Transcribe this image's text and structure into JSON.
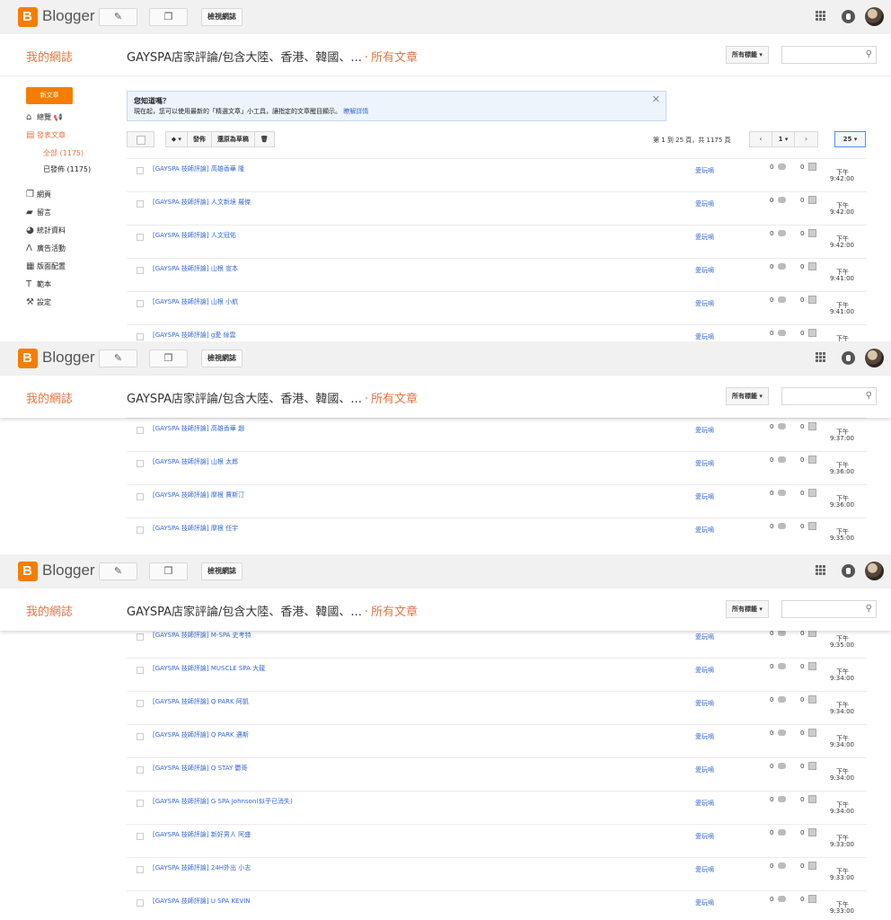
{
  "topbar": {
    "logo_letter": "B",
    "brand": "Blogger",
    "view_blog": "檢視網誌",
    "pencil_icon": "pencil-icon",
    "pages_icon": "pages-icon"
  },
  "header": {
    "blog_name": "我的網誌",
    "blog_title": "GAYSPA店家評論/包含大陸、香港、韓國、...",
    "separator": "·",
    "section": "所有文章",
    "labels_dropdown": "所有標籤 ▾"
  },
  "sidebar": {
    "new_post": "新文章",
    "items": [
      {
        "label": "總覽",
        "icon": "home-icon"
      },
      {
        "label": "發表文章",
        "icon": "posts-icon"
      },
      {
        "label": "全部 (1175)"
      },
      {
        "label": "已發佈 (1175)"
      },
      {
        "label": "網頁",
        "icon": "pages-icon"
      },
      {
        "label": "留言",
        "icon": "comments-icon"
      },
      {
        "label": "統計資料",
        "icon": "stats-icon"
      },
      {
        "label": "廣告活動",
        "icon": "earnings-icon"
      },
      {
        "label": "版面配置",
        "icon": "layout-icon"
      },
      {
        "label": "範本",
        "icon": "theme-icon"
      },
      {
        "label": "設定",
        "icon": "settings-icon"
      }
    ]
  },
  "notice": {
    "title": "您知道嗎？",
    "body": "現在起，您可以使用最新的「精選文章」小工具，讓指定的文章醒目顯示。",
    "link": "瞭解詳情"
  },
  "toolbar": {
    "label_btn": "▾",
    "publish": "發佈",
    "revert": "還原為草稿",
    "delete_icon": "trash-icon",
    "page_info": "第 1 到 25 頁，共 1175 頁",
    "page_prev": "‹",
    "page_num": "1 ▾",
    "page_next": "›",
    "per_page": "25 ▾"
  },
  "posts": [
    {
      "title": "[GAYSPA 技師評論] 高雄香華 隆",
      "author": "愛玩嘀",
      "comments": "0",
      "views": "0",
      "ampm": "下午",
      "time": "9:42:00"
    },
    {
      "title": "[GAYSPA 技師評論] 人文新境 羅傑",
      "author": "愛玩嘀",
      "comments": "0",
      "views": "0",
      "ampm": "下午",
      "time": "9:42:00"
    },
    {
      "title": "[GAYSPA 技師評論] 人文冠佑",
      "author": "愛玩嘀",
      "comments": "0",
      "views": "0",
      "ampm": "下午",
      "time": "9:42:00"
    },
    {
      "title": "[GAYSPA 技師評論] 山根 宣本",
      "author": "愛玩嘀",
      "comments": "0",
      "views": "0",
      "ampm": "下午",
      "time": "9:41:00"
    },
    {
      "title": "[GAYSPA 技師評論] 山根 小航",
      "author": "愛玩嘀",
      "comments": "0",
      "views": "0",
      "ampm": "下午",
      "time": "9:41:00"
    },
    {
      "title": "[GAYSPA 技師評論] g愛 絲雲",
      "author": "愛玩嘀",
      "comments": "0",
      "views": "0",
      "ampm": "下午",
      "time": ""
    },
    {
      "title": "[GAYSPA 技師評論] 高雄香華 趙",
      "author": "愛玩嘀",
      "comments": "0",
      "views": "0",
      "ampm": "下午",
      "time": "9:37:00"
    },
    {
      "title": "[GAYSPA 技師評論] 山根 太郎",
      "author": "愛玩嘀",
      "comments": "0",
      "views": "0",
      "ampm": "下午",
      "time": "9:36:00"
    },
    {
      "title": "[GAYSPA 技師評論] 摩根 賈斯汀",
      "author": "愛玩嘀",
      "comments": "0",
      "views": "0",
      "ampm": "下午",
      "time": "9:36:00"
    },
    {
      "title": "[GAYSPA 技師評論] 摩根 任宇",
      "author": "愛玩嘀",
      "comments": "0",
      "views": "0",
      "ampm": "下午",
      "time": "9:35:00"
    },
    {
      "title": "[GAYSPA 技師評論] M-SPA 史考特",
      "author": "愛玩嘀",
      "comments": "0",
      "views": "0",
      "ampm": "下午",
      "time": "9:35:00"
    },
    {
      "title": "[GAYSPA 技師評論] MUSCLE SPA 大龍",
      "author": "愛玩嘀",
      "comments": "0",
      "views": "0",
      "ampm": "下午",
      "time": "9:34:00"
    },
    {
      "title": "[GAYSPA 技師評論] Q PARK 阿凱",
      "author": "愛玩嘀",
      "comments": "0",
      "views": "0",
      "ampm": "下午",
      "time": "9:34:00"
    },
    {
      "title": "[GAYSPA 技師評論] Q PARK 邁斯",
      "author": "愛玩嘀",
      "comments": "0",
      "views": "0",
      "ampm": "下午",
      "time": "9:34:00"
    },
    {
      "title": "[GAYSPA 技師評論] Q STAY 鬱哥",
      "author": "愛玩嘀",
      "comments": "0",
      "views": "0",
      "ampm": "下午",
      "time": "9:34:00"
    },
    {
      "title": "[GAYSPA 技師評論] G SPA Johnson(似乎已消失)",
      "author": "愛玩嘀",
      "comments": "0",
      "views": "0",
      "ampm": "下午",
      "time": "9:34:00"
    },
    {
      "title": "[GAYSPA 技師評論] 新好男人 阿盛",
      "author": "愛玩嘀",
      "comments": "0",
      "views": "0",
      "ampm": "下午",
      "time": "9:33:00"
    },
    {
      "title": "[GAYSPA 技師評論] 24H外出 小志",
      "author": "愛玩嘀",
      "comments": "0",
      "views": "0",
      "ampm": "下午",
      "time": "9:33:00"
    },
    {
      "title": "[GAYSPA 技師評論] U SPA KEVIN",
      "author": "愛玩嘀",
      "comments": "0",
      "views": "0",
      "ampm": "下午",
      "time": "9:33:00"
    }
  ]
}
